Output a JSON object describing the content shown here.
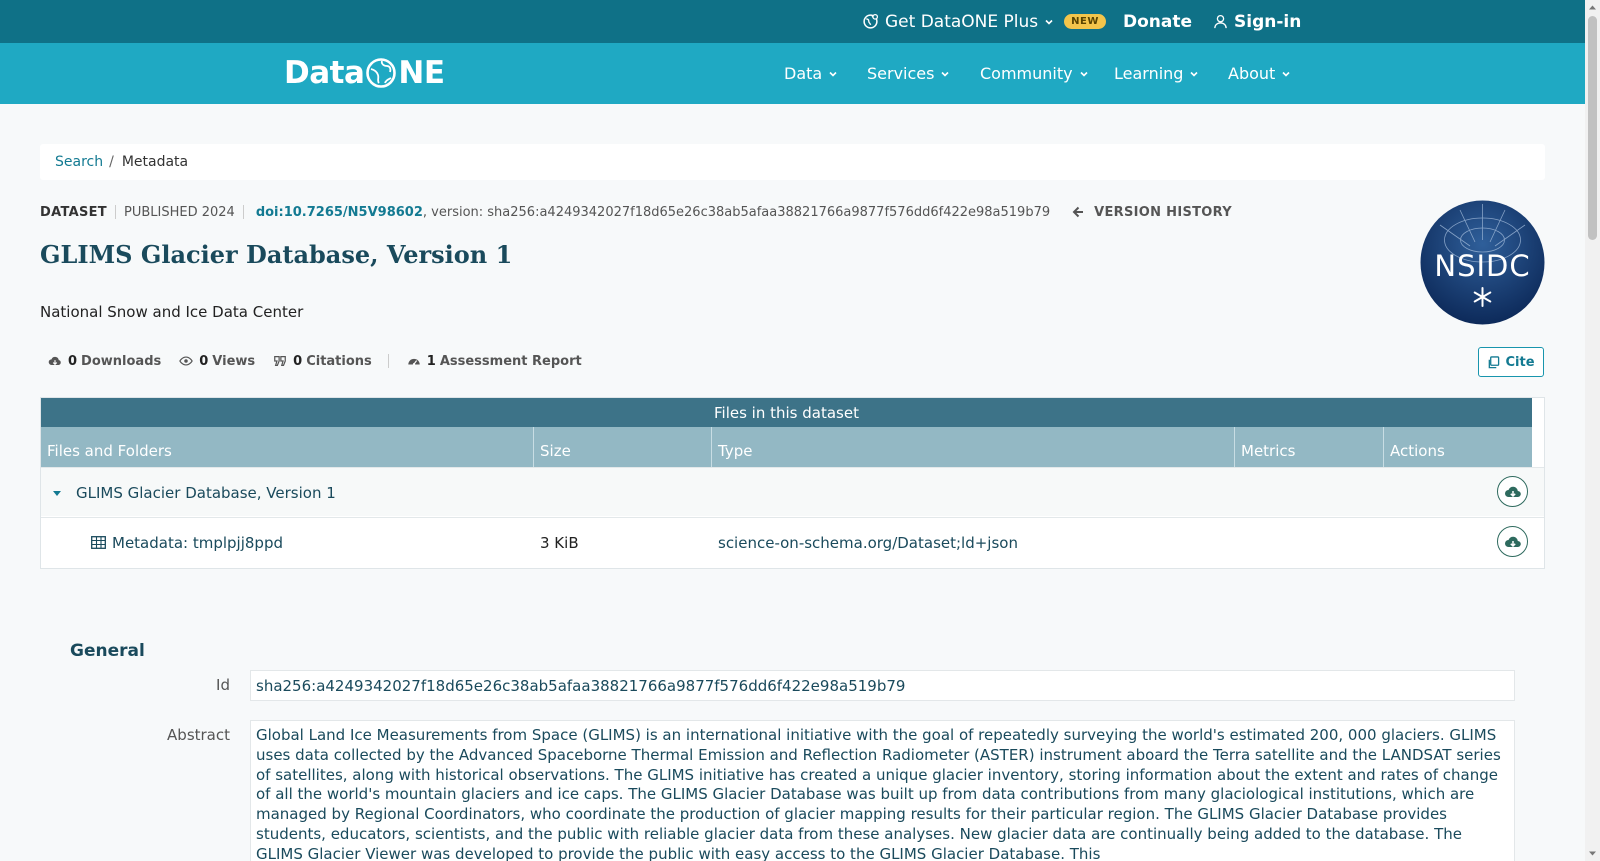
{
  "topbar": {
    "plus_label": "Get DataONE Plus",
    "new_badge": "NEW",
    "donate_label": "Donate",
    "signin_label": "Sign-in"
  },
  "navbar": {
    "logo_left": "Data",
    "logo_right": "NE",
    "items": [
      {
        "label": "Data"
      },
      {
        "label": "Services"
      },
      {
        "label": "Community"
      },
      {
        "label": "Learning"
      },
      {
        "label": "About"
      }
    ]
  },
  "breadcrumb": {
    "search": "Search",
    "separator": "/",
    "current": "Metadata"
  },
  "dataset": {
    "kind": "DATASET",
    "published": "PUBLISHED 2024",
    "doi": "doi:10.7265/N5V98602",
    "version_text": ", version: sha256:a4249342027f18d65e26c38ab5afaa38821766a9877f576dd6f422e98a519b79",
    "version_history": "VERSION HISTORY",
    "title": "GLIMS Glacier Database, Version 1",
    "organization": "National Snow and Ice Data Center",
    "logo_text": "NSIDC"
  },
  "metrics": {
    "downloads_count": "0",
    "downloads_label": "Downloads",
    "views_count": "0",
    "views_label": "Views",
    "citations_count": "0",
    "citations_label": "Citations",
    "assessment_count": "1",
    "assessment_label": "Assessment Report",
    "cite_label": "Cite"
  },
  "files_table": {
    "caption": "Files in this dataset",
    "columns": [
      "Files and Folders",
      "Size",
      "Type",
      "Metrics",
      "Actions"
    ],
    "rows": [
      {
        "name": "GLIMS Glacier Database, Version 1",
        "size": "",
        "type": ""
      },
      {
        "name": "Metadata: tmplpjj8ppd",
        "size": "3 KiB",
        "type": "science-on-schema.org/Dataset;ld+json"
      }
    ]
  },
  "general": {
    "heading": "General",
    "id_label": "Id",
    "id_value": "sha256:a4249342027f18d65e26c38ab5afaa38821766a9877f576dd6f422e98a519b79",
    "abstract_label": "Abstract",
    "abstract_text": "Global Land Ice Measurements from Space (GLIMS) is an international initiative with the goal of repeatedly surveying the world's estimated 200, 000 glaciers. GLIMS uses data collected by the Advanced Spaceborne Thermal Emission and Reflection Radiometer (ASTER) instrument aboard the Terra satellite and the LANDSAT series of satellites, along with historical observations. The GLIMS initiative has created a unique glacier inventory, storing information about the extent and rates of change of all the world's mountain glaciers and ice caps. The GLIMS Glacier Database was built up from data contributions from many glaciological institutions, which are managed by Regional Coordinators, who coordinate the production of glacier mapping results for their particular region. The GLIMS Glacier Database provides students, educators, scientists, and the public with reliable glacier data from these analyses. New glacier data are continually being added to the database. The GLIMS Glacier Viewer was developed to provide the public with easy access to the GLIMS Glacier Database. This"
  },
  "icons": {
    "plus": "globe-icon",
    "signin": "user-icon",
    "version_history": "arrow-left-icon",
    "downloads": "cloud-download-icon",
    "views": "eye-icon",
    "citations": "quote-icon",
    "assessment": "gauge-icon",
    "cite": "copy-icon",
    "folder_toggle": "caret-down-icon",
    "metadata_file": "table-icon",
    "row_action": "cloud-download-icon"
  },
  "colors": {
    "topbar": "#0f7187",
    "navbar": "#1fa9c3",
    "link": "#137a92",
    "table_caption": "#3d7388",
    "table_header": "#93b8c4",
    "badge": "#f3c54b"
  }
}
